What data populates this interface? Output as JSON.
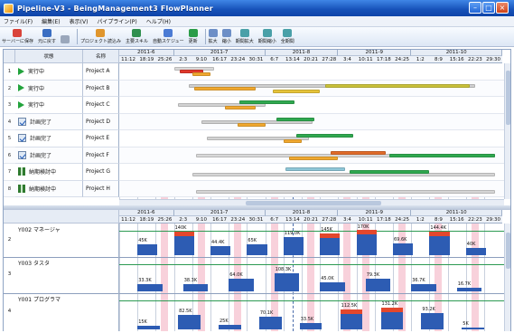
{
  "window": {
    "title": "Pipeline-V3 - BeingManagement3 FlowPlanner"
  },
  "menu": [
    "ファイル(F)",
    "編集(E)",
    "表示(V)",
    "パイプライン(P)",
    "ヘルプ(H)"
  ],
  "toolbar": [
    {
      "label": "サーバーに保存",
      "icon": "save-icon",
      "color": "#d9443a"
    },
    {
      "label": "元に戻す",
      "icon": "undo-icon",
      "color": "#3a6ec2"
    },
    {
      "label": "",
      "icon": "redo-icon",
      "color": "#9aa7bb"
    },
    {
      "label": "プロジェクト読込み",
      "icon": "load-project-icon",
      "color": "#e0962d"
    },
    {
      "label": "主要スキル",
      "icon": "skill-icon",
      "color": "#2f8f4e"
    },
    {
      "label": "自動スケジュー",
      "icon": "auto-schedule-icon",
      "color": "#4b7bd4"
    },
    {
      "label": "更新",
      "icon": "refresh-icon",
      "color": "#2a9c48"
    },
    {
      "label": "拡大",
      "icon": "zoom-in-icon",
      "color": "#6d8fc7"
    },
    {
      "label": "縮小",
      "icon": "zoom-out-icon",
      "color": "#6d8fc7"
    },
    {
      "label": "期間拡大",
      "icon": "expand-period-icon",
      "color": "#4aa0a8"
    },
    {
      "label": "期間縮小",
      "icon": "shrink-period-icon",
      "color": "#4aa0a8"
    },
    {
      "label": "全期間",
      "icon": "full-period-icon",
      "color": "#4aa0a8"
    }
  ],
  "grid": {
    "col_status": "状態",
    "col_name": "名称",
    "rows": [
      {
        "num": "1",
        "status": "実行中",
        "status_icon": "running-icon",
        "name": "Project A"
      },
      {
        "num": "2",
        "status": "実行中",
        "status_icon": "running-icon",
        "name": "Project B"
      },
      {
        "num": "3",
        "status": "実行中",
        "status_icon": "running-icon",
        "name": "Project C"
      },
      {
        "num": "4",
        "status": "計画完了",
        "status_icon": "plan-done-icon",
        "name": "Project D"
      },
      {
        "num": "5",
        "status": "計画完了",
        "status_icon": "plan-done-icon",
        "name": "Project E"
      },
      {
        "num": "6",
        "status": "計画完了",
        "status_icon": "plan-done-icon",
        "name": "Project F"
      },
      {
        "num": "7",
        "status": "納期検討中",
        "status_icon": "waiting-icon",
        "name": "Project G"
      },
      {
        "num": "8",
        "status": "納期検討中",
        "status_icon": "waiting-icon",
        "name": "Project H"
      }
    ]
  },
  "timeline": {
    "months": [
      "2011-6",
      "2011-7",
      "2011-8",
      "2011-9",
      "2011-10"
    ],
    "days": [
      "11:12",
      "18:19",
      "25:26",
      "2:3",
      "9:10",
      "16:17",
      "23:24",
      "30:31",
      "6:7",
      "13:14",
      "20:21",
      "27:28",
      "3:4",
      "10:11",
      "17:18",
      "24:25",
      "1:2",
      "8:9",
      "15:16",
      "22:23",
      "29:30"
    ]
  },
  "resources": [
    {
      "num": "2",
      "label": "Y002 マネージャ",
      "values": [
        "45K",
        "140K",
        "44.4K",
        "65K",
        "119.0K",
        "145K",
        "170K",
        "69.6K",
        "144.4K",
        "40K"
      ]
    },
    {
      "num": "3",
      "label": "Y003 タスタ",
      "values": [
        "33.3K",
        "38.3K",
        "64.0K",
        "108.3K",
        "45.0K",
        "79.3K",
        "36.7K",
        "16.7K"
      ]
    },
    {
      "num": "4",
      "label": "Y001 プログラマ",
      "values": [
        "15K",
        "82.5K",
        "25K",
        "70.1K",
        "33.5K",
        "112.5K",
        "131.2K",
        "93.2K",
        "5K"
      ]
    }
  ],
  "colors": {
    "accent": "#1651b8",
    "running": "#22a33c",
    "holiday": "#f6c2cf",
    "load": "#2d5cb3",
    "overload": "#e3472c"
  }
}
